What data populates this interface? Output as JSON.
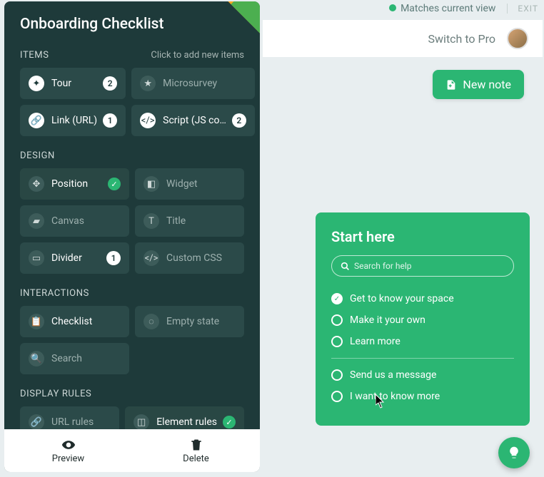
{
  "header": {
    "title": "Onboarding Checklist"
  },
  "topbar": {
    "status": "Matches current view",
    "exit": "EXIT"
  },
  "content_header": {
    "switch_label": "Switch to Pro"
  },
  "new_note": {
    "label": "New note"
  },
  "sections": {
    "items": {
      "label": "ITEMS",
      "hint": "Click to add new items"
    },
    "design": {
      "label": "DESIGN"
    },
    "interactions": {
      "label": "INTERACTIONS"
    },
    "display_rules": {
      "label": "DISPLAY RULES"
    }
  },
  "tiles": {
    "tour": {
      "label": "Tour",
      "count": 2
    },
    "microsurvey": {
      "label": "Microsurvey"
    },
    "link": {
      "label": "Link (URL)",
      "count": 1
    },
    "script": {
      "label": "Script (JS co…",
      "count": 2
    },
    "position": {
      "label": "Position",
      "checked": true
    },
    "widget": {
      "label": "Widget"
    },
    "canvas": {
      "label": "Canvas"
    },
    "title": {
      "label": "Title"
    },
    "divider": {
      "label": "Divider",
      "count": 1
    },
    "custom_css": {
      "label": "Custom CSS"
    },
    "checklist": {
      "label": "Checklist"
    },
    "empty_state": {
      "label": "Empty state"
    },
    "search": {
      "label": "Search"
    },
    "url_rules": {
      "label": "URL rules"
    },
    "element_rules": {
      "label": "Element rules",
      "checked": true
    }
  },
  "footer": {
    "preview": "Preview",
    "delete": "Delete"
  },
  "panel": {
    "title": "Start here",
    "search_placeholder": "Search for help",
    "items": [
      {
        "label": "Get to know your space",
        "done": true
      },
      {
        "label": "Make it your own",
        "done": false
      },
      {
        "label": "Learn more",
        "done": false
      }
    ],
    "extra": [
      {
        "label": "Send us a message",
        "done": false
      },
      {
        "label": "I want to know more",
        "done": false
      }
    ]
  }
}
